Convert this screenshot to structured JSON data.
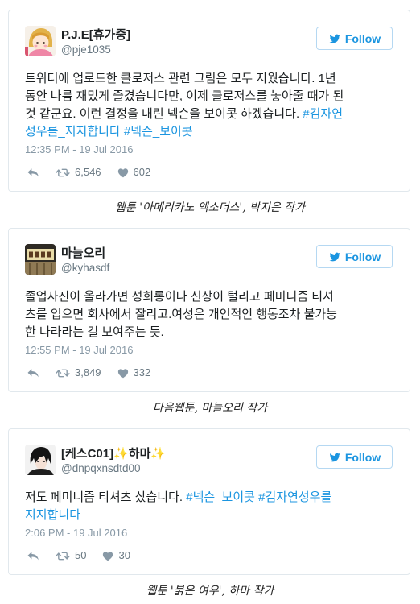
{
  "colors": {
    "link": "#1b95e0",
    "text": "#1c2022",
    "muted": "#8899a6",
    "border": "#e1e8ed",
    "button_border": "#b5d8f2",
    "caption": "#222222"
  },
  "icons": {
    "follow": "twitter-bird-icon",
    "reply": "reply-icon",
    "retweet": "retweet-icon",
    "like": "heart-icon"
  },
  "tweets": [
    {
      "author": {
        "name": "P.J.E[휴가중]",
        "handle": "@pje1035",
        "avatar": "avatar-pje-icon"
      },
      "follow_label": "Follow",
      "lines": [
        [
          {
            "text": "트위터에 업로드한 클로저스 관련 그림은 모두 지웠습니다. 1년"
          }
        ],
        [
          {
            "text": "동안 나름 재밌게 즐겼습니다만, 이제 클로저스를 놓아줄 때가 된"
          }
        ],
        [
          {
            "text": "것 같군요. 이런 결정을 내린 넥슨을 보이콧 하겠습니다. "
          },
          {
            "text": "#김자연",
            "hashtag": true
          }
        ],
        [
          {
            "text": "성우를_지지합니다",
            "hashtag": true
          },
          {
            "text": " "
          },
          {
            "text": "#넥슨_보이콧",
            "hashtag": true
          }
        ]
      ],
      "timestamp": "12:35 PM - 19 Jul 2016",
      "retweets": "6,546",
      "likes": "602"
    },
    {
      "author": {
        "name": "마늘오리",
        "handle": "@kyhasdf",
        "avatar": "avatar-kyhasdf-icon"
      },
      "follow_label": "Follow",
      "lines": [
        [
          {
            "text": "졸업사진이 올라가면 성희롱이나 신상이 털리고 페미니즘 티셔"
          }
        ],
        [
          {
            "text": "츠를 입으면 회사에서 잘리고.여성은 개인적인 행동조차 불가능"
          }
        ],
        [
          {
            "text": "한 나라라는 걸 보여주는 듯."
          }
        ]
      ],
      "timestamp": "12:55 PM - 19 Jul 2016",
      "retweets": "3,849",
      "likes": "332"
    },
    {
      "author": {
        "name": "[케스C01]✨하마✨",
        "handle": "@dnpqxnsdtd00",
        "avatar": "avatar-dnpqxnsdtd00-icon"
      },
      "follow_label": "Follow",
      "lines": [
        [
          {
            "text": "저도 페미니즘 티셔츠 샀습니다. "
          },
          {
            "text": "#넥슨_보이콧",
            "hashtag": true
          },
          {
            "text": " "
          },
          {
            "text": "#김자연성우를_",
            "hashtag": true
          }
        ],
        [
          {
            "text": "지지합니다",
            "hashtag": true
          }
        ]
      ],
      "timestamp": "2:06 PM - 19 Jul 2016",
      "retweets": "50",
      "likes": "30"
    }
  ],
  "captions": [
    "웹툰 '아메리카노 엑소더스', 박지은 작가",
    "다음웹툰, 마늘오리 작가",
    "웹툰 '붉은 여우', 하마 작가"
  ]
}
